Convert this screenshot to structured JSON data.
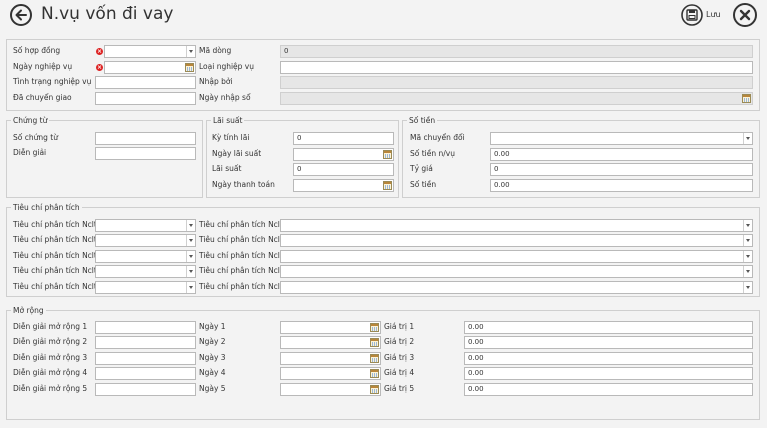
{
  "header": {
    "title": "N.vụ vốn đi vay",
    "save_label": "Lưu"
  },
  "general": {
    "contract_label": "Số hợp đồng",
    "contract_value": "",
    "business_date_label": "Ngày nghiệp vụ",
    "business_date_value": "",
    "status_label": "Tình trạng nghiệp vụ",
    "status_value": "",
    "transferred_label": "Đã chuyển giao",
    "transferred_value": "",
    "line_code_label": "Mã dòng",
    "line_code_value": "0",
    "business_type_label": "Loại nghiệp vụ",
    "business_type_value": "",
    "entered_by_label": "Nhập bởi",
    "entered_by_value": "",
    "entry_date_label": "Ngày nhập sổ",
    "entry_date_value": ""
  },
  "voucher": {
    "legend": "Chứng từ",
    "number_label": "Số chứng từ",
    "number_value": "",
    "description_label": "Diễn giải",
    "description_value": ""
  },
  "interest": {
    "legend": "Lãi suất",
    "period_label": "Kỳ tính lãi",
    "period_value": "0",
    "rate_date_label": "Ngày lãi suất",
    "rate_date_value": "",
    "rate_label": "Lãi suất",
    "rate_value": "0",
    "payment_date_label": "Ngày thanh toán",
    "payment_date_value": ""
  },
  "money": {
    "legend": "Số tiền",
    "currency_code_label": "Mã chuyển đổi",
    "currency_code_value": "",
    "amount_fc_label": "Số tiền n/vụ",
    "amount_fc_value": "0.00",
    "rate_label": "Tỷ giá",
    "rate_value": "0",
    "amount_label": "Số tiền",
    "amount_value": "0.00"
  },
  "criteria": {
    "legend": "Tiêu chí phân tích",
    "left": [
      {
        "label": "Tiêu chí phân tích Nclt0",
        "value": ""
      },
      {
        "label": "Tiêu chí phân tích Nclt1",
        "value": ""
      },
      {
        "label": "Tiêu chí phân tích Nclt2",
        "value": ""
      },
      {
        "label": "Tiêu chí phân tích Nclt3",
        "value": ""
      },
      {
        "label": "Tiêu chí phân tích Nclt4",
        "value": ""
      }
    ],
    "right": [
      {
        "label": "Tiêu chí phân tích Nclt5",
        "value": ""
      },
      {
        "label": "Tiêu chí phân tích Nclt6",
        "value": ""
      },
      {
        "label": "Tiêu chí phân tích Nclt7",
        "value": ""
      },
      {
        "label": "Tiêu chí phân tích Nclt8",
        "value": ""
      },
      {
        "label": "Tiêu chí phân tích Nclt9",
        "value": ""
      }
    ]
  },
  "extended": {
    "legend": "Mở rộng",
    "descriptions": [
      {
        "label": "Diễn giải mở rộng 1",
        "value": ""
      },
      {
        "label": "Diễn giải mở rộng 2",
        "value": ""
      },
      {
        "label": "Diễn giải mở rộng 3",
        "value": ""
      },
      {
        "label": "Diễn giải mở rộng 4",
        "value": ""
      },
      {
        "label": "Diễn giải mở rộng 5",
        "value": ""
      }
    ],
    "dates": [
      {
        "label": "Ngày 1",
        "value": ""
      },
      {
        "label": "Ngày 2",
        "value": ""
      },
      {
        "label": "Ngày 3",
        "value": ""
      },
      {
        "label": "Ngày 4",
        "value": ""
      },
      {
        "label": "Ngày 5",
        "value": ""
      }
    ],
    "values": [
      {
        "label": "Giá trị 1",
        "value": "0.00"
      },
      {
        "label": "Giá trị 2",
        "value": "0.00"
      },
      {
        "label": "Giá trị 3",
        "value": "0.00"
      },
      {
        "label": "Giá trị 4",
        "value": "0.00"
      },
      {
        "label": "Giá trị 5",
        "value": "0.00"
      }
    ]
  }
}
